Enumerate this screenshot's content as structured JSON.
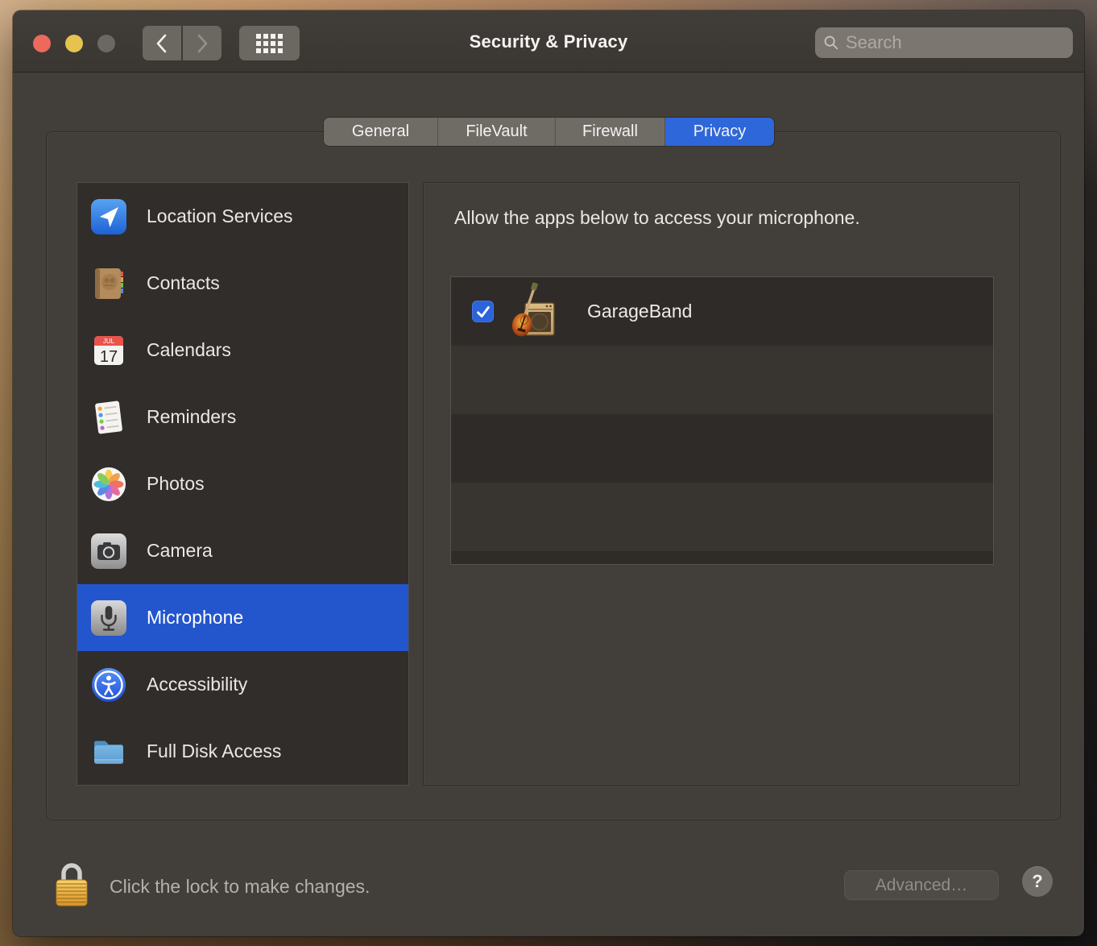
{
  "titlebar": {
    "title": "Security & Privacy",
    "search_placeholder": "Search",
    "traffic_lights": [
      "close",
      "minimize",
      "zoom"
    ]
  },
  "tabs": [
    {
      "label": "General",
      "selected": false
    },
    {
      "label": "FileVault",
      "selected": false
    },
    {
      "label": "Firewall",
      "selected": false
    },
    {
      "label": "Privacy",
      "selected": true
    }
  ],
  "sidebar": {
    "items": [
      {
        "label": "Location Services",
        "icon": "location-icon"
      },
      {
        "label": "Contacts",
        "icon": "contacts-icon"
      },
      {
        "label": "Calendars",
        "icon": "calendar-icon"
      },
      {
        "label": "Reminders",
        "icon": "reminders-icon"
      },
      {
        "label": "Photos",
        "icon": "photos-icon"
      },
      {
        "label": "Camera",
        "icon": "camera-icon"
      },
      {
        "label": "Microphone",
        "icon": "microphone-icon"
      },
      {
        "label": "Accessibility",
        "icon": "accessibility-icon"
      },
      {
        "label": "Full Disk Access",
        "icon": "folder-icon"
      }
    ],
    "selected_label": "Microphone",
    "calendar_icon": {
      "month": "JUL",
      "day": "17"
    }
  },
  "panel": {
    "heading": "Allow the apps below to access your microphone.",
    "apps": [
      {
        "name": "GarageBand",
        "checked": true
      }
    ]
  },
  "footer": {
    "lock_text": "Click the lock to make changes.",
    "advanced_label": "Advanced…",
    "help_label": "?"
  },
  "colors": {
    "tab_accent": "#2e67da",
    "sidebar_selected": "#2356cd",
    "checkbox_accent": "#2a63dc",
    "window_bg": "#423e3a",
    "sidebar_bg": "#312d2a",
    "list_row_dark": "#2f2b28",
    "list_row_light": "#383430"
  }
}
